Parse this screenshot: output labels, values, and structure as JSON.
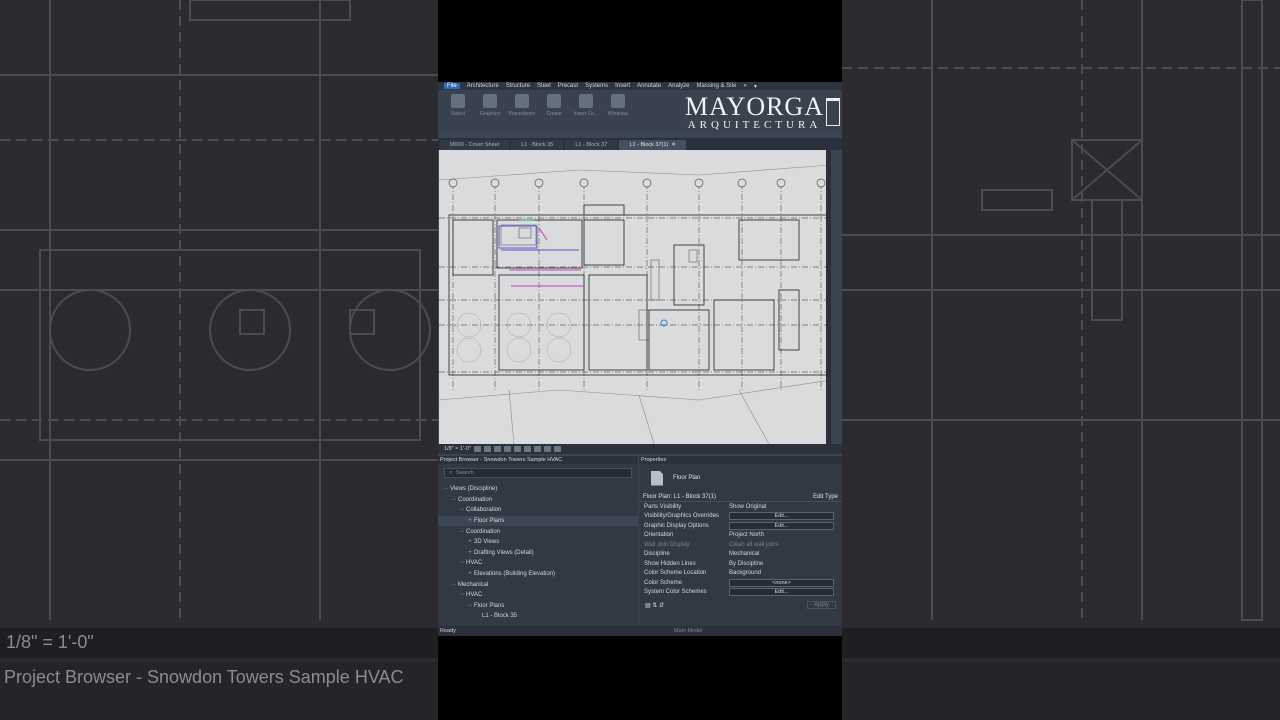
{
  "menu": {
    "items": [
      "File",
      "Architecture",
      "Structure",
      "Steel",
      "Precast",
      "Systems",
      "Insert",
      "Annotate",
      "Analyze",
      "Massing & Site",
      "»",
      "▾"
    ]
  },
  "ribbon": {
    "tools": [
      "Select",
      "Graphics",
      "Precedence",
      "Create",
      "Insert Co...",
      "Windows"
    ]
  },
  "logo": {
    "line1": "MAYORGA",
    "line2": "ARQUITECTURA"
  },
  "tabs": [
    {
      "label": "M000 - Cover Sheet",
      "active": false
    },
    {
      "label": "L1 - Block 35",
      "active": false
    },
    {
      "label": "L1 - Block 37",
      "active": false
    },
    {
      "label": "L1 - Block 37(1)",
      "active": true
    }
  ],
  "viewbar": {
    "scale": "1/8\" = 1'-0\""
  },
  "project_browser": {
    "title": "Project Browser - Snowdon Towers Sample HVAC",
    "search_placeholder": "Search",
    "tree": [
      {
        "toggle": "−",
        "label": "Views (Discipline)",
        "level": 0
      },
      {
        "toggle": "−",
        "label": "Coordination",
        "level": 1
      },
      {
        "toggle": "−",
        "label": "Collaboration",
        "level": 2
      },
      {
        "toggle": "+",
        "label": "Floor Plans",
        "level": 3,
        "selected": true
      },
      {
        "toggle": "−",
        "label": "Coordination",
        "level": 2
      },
      {
        "toggle": "+",
        "label": "3D Views",
        "level": 3
      },
      {
        "toggle": "+",
        "label": "Drafting Views (Detail)",
        "level": 3
      },
      {
        "toggle": "−",
        "label": "HVAC",
        "level": 2
      },
      {
        "toggle": "+",
        "label": "Elevations (Building Elevation)",
        "level": 3
      },
      {
        "toggle": "−",
        "label": "Mechanical",
        "level": 1
      },
      {
        "toggle": "−",
        "label": "HVAC",
        "level": 2
      },
      {
        "toggle": "−",
        "label": "Floor Plans",
        "level": 3
      },
      {
        "toggle": "",
        "label": "L1 - Block 35",
        "level": 4
      }
    ]
  },
  "properties": {
    "title": "Properties",
    "type_name": "Floor Plan",
    "selector": "Floor Plan: L1 - Block 37(1)",
    "edit_type": "Edit Type",
    "rows": [
      {
        "key": "Parts Visibility",
        "value": "Show Original",
        "kind": "text"
      },
      {
        "key": "Visibility/Graphics Overrides",
        "value": "Edit...",
        "kind": "button"
      },
      {
        "key": "Graphic Display Options",
        "value": "Edit...",
        "kind": "button"
      },
      {
        "key": "Orientation",
        "value": "Project North",
        "kind": "text"
      },
      {
        "key": "Wall Join Display",
        "value": "Clean all wall joins",
        "kind": "dim"
      },
      {
        "key": "Discipline",
        "value": "Mechanical",
        "kind": "text"
      },
      {
        "key": "Show Hidden Lines",
        "value": "By Discipline",
        "kind": "text"
      },
      {
        "key": "Color Scheme Location",
        "value": "Background",
        "kind": "text"
      },
      {
        "key": "Color Scheme",
        "value": "<none>",
        "kind": "button"
      },
      {
        "key": "System Color Schemes",
        "value": "Edit...",
        "kind": "button"
      }
    ],
    "apply": "Apply"
  },
  "status": {
    "text": "Ready",
    "model": "Main Model"
  },
  "background": {
    "left_scale": "1/8\" = 1'-0\"",
    "left_browser": "Project Browser - Snowdon Towers Sample HVAC"
  }
}
